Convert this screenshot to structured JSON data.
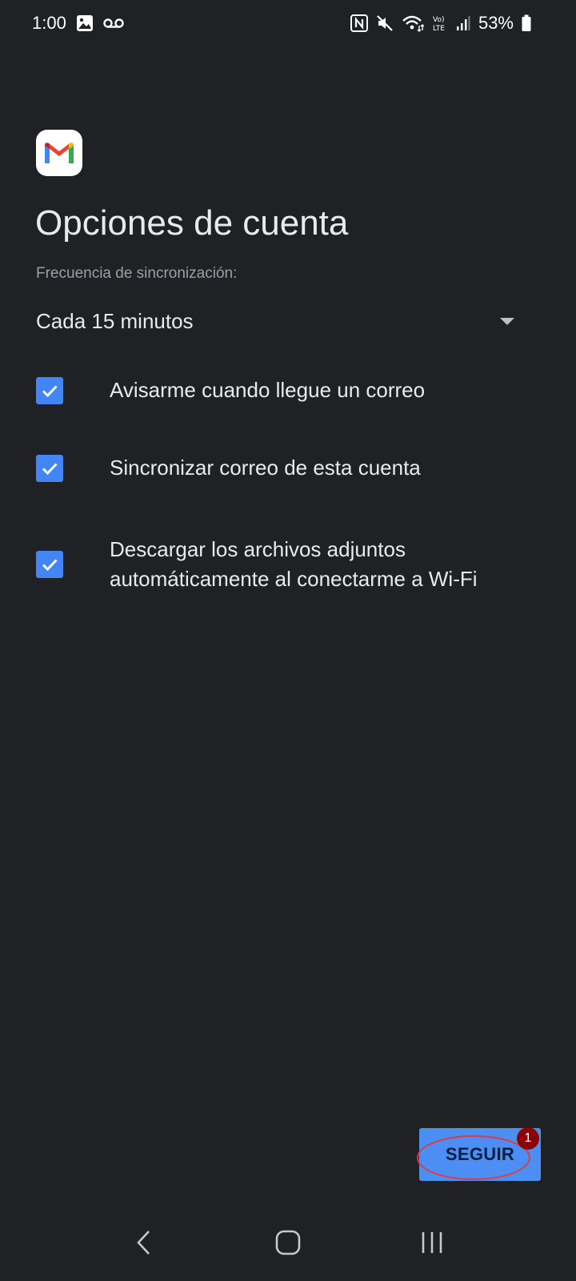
{
  "status_bar": {
    "time": "1:00",
    "battery": "53%",
    "icons": [
      "gallery-icon",
      "voicemail-icon",
      "nfc-icon",
      "mute-icon",
      "wifi-icon",
      "volte-icon",
      "signal-icon",
      "battery-icon"
    ]
  },
  "app": {
    "logo": "gmail-logo"
  },
  "page": {
    "title": "Opciones de cuenta",
    "sync_frequency_label": "Frecuencia de sincronización:",
    "sync_frequency_value": "Cada 15 minutos"
  },
  "options": [
    {
      "label": "Avisarme cuando llegue un correo",
      "checked": true
    },
    {
      "label": "Sincronizar correo de esta cuenta",
      "checked": true
    },
    {
      "label": "Descargar los archivos adjuntos automáticamente al conectarme a Wi-Fi",
      "checked": true
    }
  ],
  "actions": {
    "continue_label": "SEGUIR"
  },
  "annotation": {
    "badge": "1"
  },
  "colors": {
    "background": "#202124",
    "accent": "#4285f4",
    "annotation": "#e53935"
  },
  "nav_bar": {
    "buttons": [
      "back-icon",
      "home-icon",
      "recents-icon"
    ]
  }
}
